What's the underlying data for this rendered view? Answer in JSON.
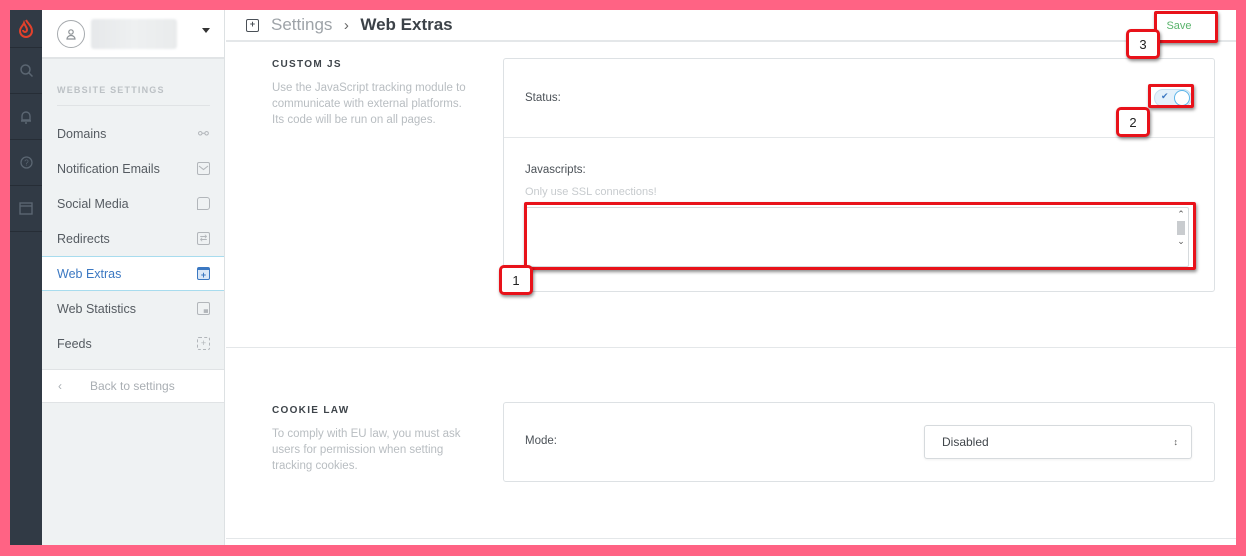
{
  "rail": {
    "items": [
      {
        "icon": "logo-flame-icon"
      },
      {
        "icon": "search-icon"
      },
      {
        "icon": "bell-icon"
      },
      {
        "icon": "help-icon"
      },
      {
        "icon": "window-icon"
      }
    ]
  },
  "account": {
    "icon": "user-icon"
  },
  "sidebar": {
    "heading": "WEBSITE SETTINGS",
    "items": [
      {
        "label": "Domains",
        "icon": "link-icon",
        "glyph": "⚯",
        "active": false
      },
      {
        "label": "Notification Emails",
        "icon": "email-icon",
        "glyph": "",
        "active": false
      },
      {
        "label": "Social Media",
        "icon": "chat-icon",
        "glyph": "",
        "active": false
      },
      {
        "label": "Redirects",
        "icon": "redirect-icon",
        "glyph": "⇄",
        "active": false
      },
      {
        "label": "Web Extras",
        "icon": "web-extras-icon",
        "glyph": "+",
        "active": true
      },
      {
        "label": "Web Statistics",
        "icon": "chart-icon",
        "glyph": "▄",
        "active": false
      },
      {
        "label": "Feeds",
        "icon": "plus-box-icon",
        "glyph": "+",
        "active": false
      }
    ],
    "back_label": "Back to settings",
    "back_icon": "‹"
  },
  "header": {
    "icon_glyph": "+",
    "root": "Settings",
    "separator": "›",
    "current": "Web Extras",
    "save_label": "Save"
  },
  "custom_js": {
    "title": "CUSTOM JS",
    "description": "Use the JavaScript tracking module to communicate with external platforms. Its code will be run on all pages.",
    "status_label": "Status:",
    "status_enabled": true,
    "toggle_check": "✔",
    "javascripts_label": "Javascripts:",
    "javascripts_hint": "Only use SSL connections!",
    "javascripts_value": ""
  },
  "cookie_law": {
    "title": "COOKIE LAW",
    "description": "To comply with EU law, you must ask users for permission when setting tracking cookies.",
    "mode_label": "Mode:",
    "mode_value": "Disabled",
    "mode_arrows": "↕"
  },
  "annotations": [
    {
      "number": "1",
      "target": "javascripts-textarea"
    },
    {
      "number": "2",
      "target": "status-toggle"
    },
    {
      "number": "3",
      "target": "save-button"
    }
  ],
  "colors": {
    "annotation_frame": "#ff6384",
    "callout_red": "#e8121a",
    "accent_blue": "#3b78c2",
    "save_green": "#59b36b"
  }
}
